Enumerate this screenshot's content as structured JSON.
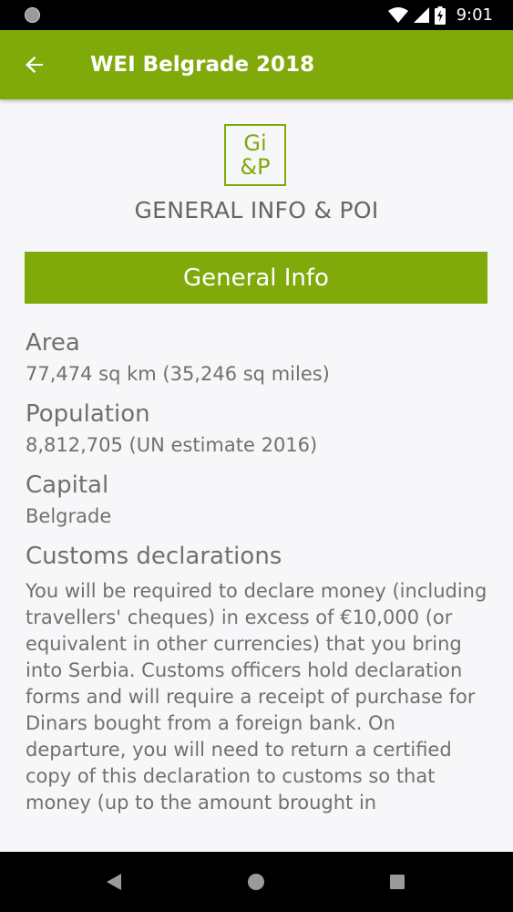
{
  "status_bar": {
    "time": "9:01",
    "icons": [
      "notification-dot-icon",
      "wifi-icon",
      "signal-icon",
      "battery-charging-icon"
    ]
  },
  "app_bar": {
    "title": "WEI Belgrade 2018",
    "back_icon": "arrow-left-icon",
    "color": "#7faa0a"
  },
  "logo": {
    "text": "Gi\n&P"
  },
  "section": {
    "title": "GENERAL INFO & POI"
  },
  "tab": {
    "label": "General Info"
  },
  "info": [
    {
      "label": "Area",
      "value": "77,474 sq km (35,246 sq miles)"
    },
    {
      "label": "Population",
      "value": "8,812,705 (UN estimate 2016)"
    },
    {
      "label": "Capital",
      "value": "Belgrade"
    },
    {
      "label": "Customs declarations",
      "value": "You will be required to declare money (including travellers' cheques) in excess of €10,000 (or equivalent in other currencies) that you bring into Serbia. Customs officers hold declaration forms and will require a receipt of purchase for Dinars bought from a foreign bank. On departure, you will need to return a certified copy of this declaration to customs so that money (up to the amount brought in"
    }
  ],
  "nav_bar": {
    "icons": [
      "nav-back-icon",
      "nav-home-icon",
      "nav-recents-icon"
    ]
  }
}
